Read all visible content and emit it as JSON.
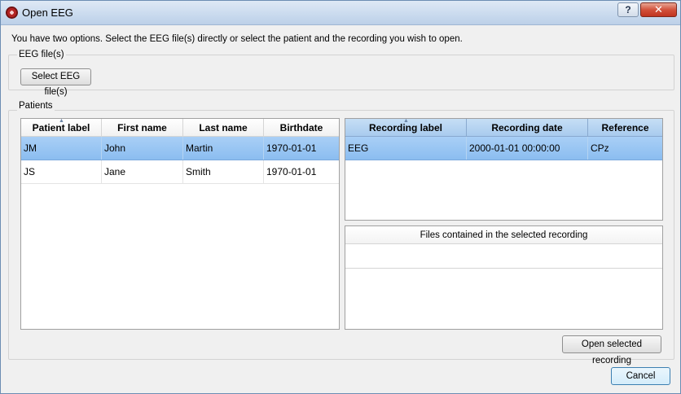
{
  "window": {
    "title": "Open EEG",
    "help_label": "?",
    "close_label": "✕"
  },
  "instructions": "You have two options. Select the EEG file(s) directly or select the patient and the recording you wish to open.",
  "eeg_files": {
    "group_label": "EEG file(s)",
    "select_button": "Select EEG file(s)"
  },
  "patients": {
    "group_label": "Patients",
    "columns": [
      "Patient label",
      "First name",
      "Last name",
      "Birthdate"
    ],
    "rows": [
      {
        "label": "JM",
        "first": "John",
        "last": "Martin",
        "birthdate": "1970-01-01",
        "selected": true
      },
      {
        "label": "JS",
        "first": "Jane",
        "last": "Smith",
        "birthdate": "1970-01-01",
        "selected": false
      }
    ]
  },
  "recordings": {
    "columns": [
      "Recording label",
      "Recording date",
      "Reference"
    ],
    "rows": [
      {
        "label": "EEG",
        "date": "2000-01-01 00:00:00",
        "reference": "CPz",
        "selected": true
      }
    ]
  },
  "files": {
    "header": "Files contained in the selected recording"
  },
  "buttons": {
    "open_selected": "Open selected recording",
    "cancel": "Cancel"
  },
  "colors": {
    "selection": "#8bbdf0",
    "header_blue": "#a9cbee",
    "title_bar": "#c9daee"
  },
  "icons": {
    "app": "eeg-app-icon",
    "sort": "sort-ascending-icon"
  }
}
